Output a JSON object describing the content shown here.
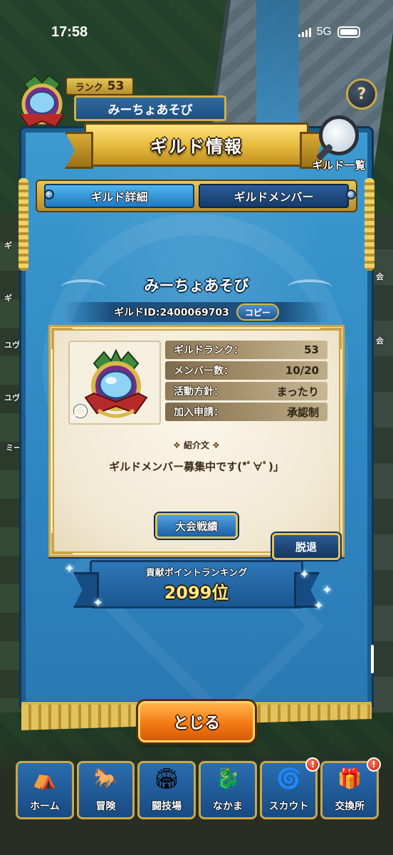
{
  "status_bar": {
    "time": "17:58",
    "network": "5G"
  },
  "background": {
    "rank_label": "ランク",
    "rank_value": "53",
    "guild_name": "みーちょあそび",
    "side_labels": [
      "ギ",
      "ギ",
      "ユヴ",
      "ユヴ",
      "ミー",
      "会",
      "会"
    ]
  },
  "help_button": {
    "label": "?"
  },
  "dialog": {
    "title": "ギルド情報",
    "guild_list_label": "ギルド一覧",
    "tabs": [
      {
        "label": "ギルド詳細",
        "active": true
      },
      {
        "label": "ギルドメンバー",
        "active": false
      }
    ],
    "guild_name": "みーちょあそび",
    "guild_id": "ギルドID:2400069703",
    "copy_label": "コピー",
    "stats": [
      {
        "label": "ギルドランク：",
        "value": "53"
      },
      {
        "label": "メンバー数：",
        "value": "10/20"
      },
      {
        "label": "活動方針：",
        "value": "まったり"
      },
      {
        "label": "加入申請：",
        "value": "承認制"
      }
    ],
    "intro_heading": "紹介文",
    "intro_text": "ギルドメンバー募集中です(*ﾟ∀ﾟ)」",
    "tournament_label": "大会戦績",
    "leave_label": "脱退",
    "ranking_label": "貢献ポイントランキング",
    "ranking_value": "2099位",
    "close_label": "とじる"
  },
  "bottom_nav": [
    {
      "label": "ホーム",
      "icon": "tent-icon",
      "glyph": "⛺",
      "badge": ""
    },
    {
      "label": "冒険",
      "icon": "wagon-icon",
      "glyph": "🐎",
      "badge": ""
    },
    {
      "label": "闘技場",
      "icon": "arena-icon",
      "glyph": "🏟",
      "badge": ""
    },
    {
      "label": "なかま",
      "icon": "party-icon",
      "glyph": "🐉",
      "badge": ""
    },
    {
      "label": "スカウト",
      "icon": "scout-icon",
      "glyph": "🌀",
      "badge": "!"
    },
    {
      "label": "交換所",
      "icon": "exchange-icon",
      "glyph": "🎁",
      "badge": "!"
    }
  ],
  "colors": {
    "banner_blue": "#2f86c2",
    "gold": "#e0c25a",
    "close_orange": "#f47a14",
    "parchment": "#f1e8d2"
  }
}
